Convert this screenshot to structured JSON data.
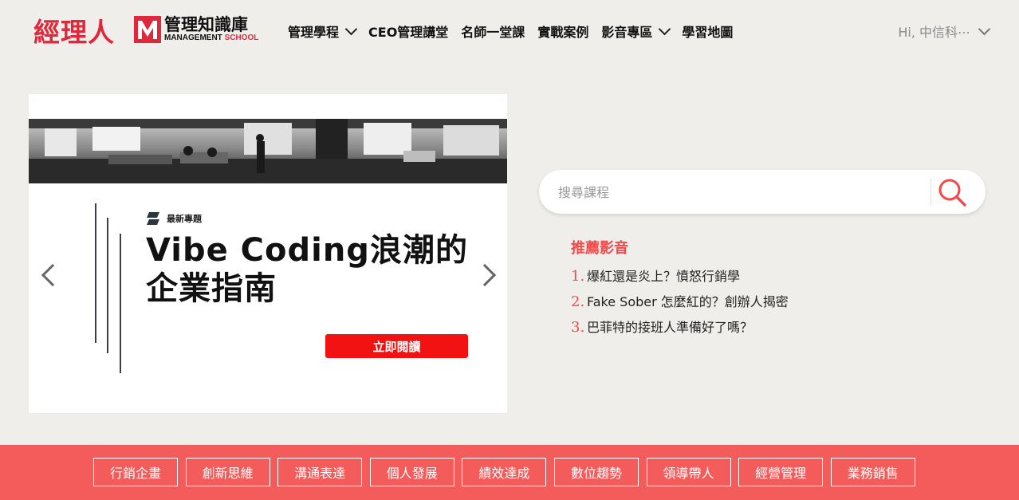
{
  "brand": {
    "name_cn": "經理人"
  },
  "logo": {
    "cn": "管理知識庫",
    "en_prefix": "MANAGEMENT",
    "en_suffix": "SCHOOL",
    "accent": "#e0283c"
  },
  "nav": {
    "items": [
      {
        "label": "管理學程",
        "dropdown": true
      },
      {
        "label": "CEO管理講堂",
        "dropdown": false
      },
      {
        "label": "名師一堂課",
        "dropdown": false
      },
      {
        "label": "實戰案例",
        "dropdown": false
      },
      {
        "label": "影音專區",
        "dropdown": true
      },
      {
        "label": "學習地圖",
        "dropdown": false
      }
    ],
    "user": "Hi, 中信科⋯"
  },
  "banner": {
    "tag": "最新專題",
    "headline": "Vibe Coding浪潮的企業指南",
    "button": "立即閱讀",
    "button_color": "#f31212"
  },
  "search": {
    "placeholder": "搜尋課程",
    "icon": "search-icon"
  },
  "recommend": {
    "title": "推薦影音",
    "items": [
      {
        "num": "1.",
        "text": "爆紅還是炎上？憤怒行銷學"
      },
      {
        "num": "2.",
        "text": "Fake Sober 怎麼紅的？創辦人揭密"
      },
      {
        "num": "3.",
        "text": "巴菲特的接班人準備好了嗎？"
      }
    ]
  },
  "categories": [
    "行銷企畫",
    "創新思維",
    "溝通表達",
    "個人發展",
    "績效達成",
    "數位趨勢",
    "領導帶人",
    "經營管理",
    "業務銷售"
  ],
  "colors": {
    "category_bar": "#f45b5b",
    "accent_red": "#f04a4a",
    "page_bg": "#efeeeb"
  }
}
